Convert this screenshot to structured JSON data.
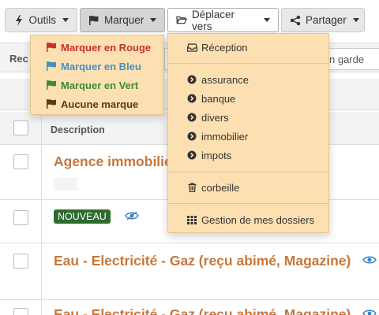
{
  "toolbar": {
    "tools_label": "Outils",
    "mark_label": "Marquer",
    "move_label": "Déplacer vers",
    "share_label": "Partager"
  },
  "filter_bar": {
    "rec_label": "Rec",
    "keep_value": "n garde"
  },
  "table": {
    "description_header": "Description",
    "rows": [
      {
        "subject": "Agence immobilie"
      },
      {
        "badge": "NOUVEAU"
      },
      {
        "subject": "Eau - Electricité - Gaz (reçu abimé, Magazine)"
      },
      {
        "subject": "Eau - Electricité - Gaz (reçu abimé, Magazine)"
      }
    ]
  },
  "mark_menu": {
    "items": [
      {
        "label": "Marquer en Rouge",
        "color": "#c9302c"
      },
      {
        "label": "Marquer en Bleu",
        "color": "#4a8fbf"
      },
      {
        "label": "Marquer en Vert",
        "color": "#3d8b37"
      },
      {
        "label": "Aucune marque",
        "color": "#5a3a1a"
      }
    ]
  },
  "move_menu": {
    "inbox": "Réception",
    "folders": [
      "assurance",
      "banque",
      "divers",
      "immobilier",
      "impots"
    ],
    "trash": "corbeille",
    "manage": "Gestion de mes dossiers"
  },
  "colors": {
    "menu_bg": "#fde0b1",
    "subject": "#c8773a",
    "badge_bg": "#2e6b2e",
    "eye": "#3a7fc1"
  }
}
